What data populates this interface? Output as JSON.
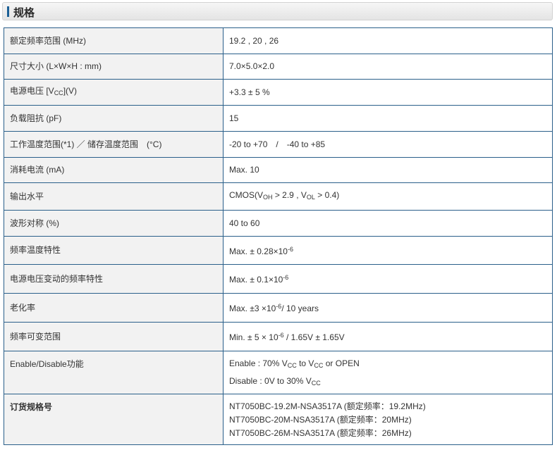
{
  "section": {
    "title": "规格"
  },
  "rows": [
    {
      "label": "额定频率范围 (MHz)",
      "value": "19.2 , 20 , 26"
    },
    {
      "label": "尺寸大小 (L×W×H : mm)",
      "value": "7.0×5.0×2.0"
    },
    {
      "label_pre": "电源电压 [V",
      "label_sub": "CC",
      "label_post": "](V)",
      "value": "+3.3 ± 5 %"
    },
    {
      "label": "负载阻抗 (pF)",
      "value": "15"
    },
    {
      "label": "工作温度范围(*1) ／ 储存温度范围　(°C)",
      "value": "-20 to +70　/　-40 to +85"
    },
    {
      "label": "消耗电流 (mA)",
      "value": "Max. 10"
    },
    {
      "label": "输出水平",
      "value_p1": "CMOS(V",
      "value_s1": "OH",
      "value_p2": " > 2.9 , V",
      "value_s2": "OL",
      "value_p3": " > 0.4)"
    },
    {
      "label": "波形对称 (%)",
      "value": "40 to 60"
    },
    {
      "label": "频率温度特性",
      "value_pre": "Max. ± 0.28×10",
      "value_sup": "-6"
    },
    {
      "label": "电源电压变动的频率特性",
      "value_pre": "Max. ± 0.1×10",
      "value_sup": "-6"
    },
    {
      "label": "老化率",
      "value_pre": "Max. ±3 ×10",
      "value_sup": "-6",
      "value_post": "/ 10 years"
    },
    {
      "label": "频率可变范围",
      "value_pre": "Min. ± 5 × 10",
      "value_sup": "-6",
      "value_post": " / 1.65V ± 1.65V"
    },
    {
      "label": "Enable/Disable功能",
      "line1": {
        "p1": "Enable : 70% V",
        "s1": "CC",
        "p2": " to V",
        "s2": "CC",
        "p3": " or OPEN"
      },
      "line2": {
        "p1": "Disable : 0V to 30% V",
        "s1": "CC"
      }
    },
    {
      "label": "订货规格号",
      "lines": [
        "NT7050BC-19.2M-NSA3517A (额定频率：19.2MHz)",
        "NT7050BC-20M-NSA3517A (额定频率：20MHz)",
        "NT7050BC-26M-NSA3517A (额定频率：26MHz)"
      ]
    }
  ]
}
